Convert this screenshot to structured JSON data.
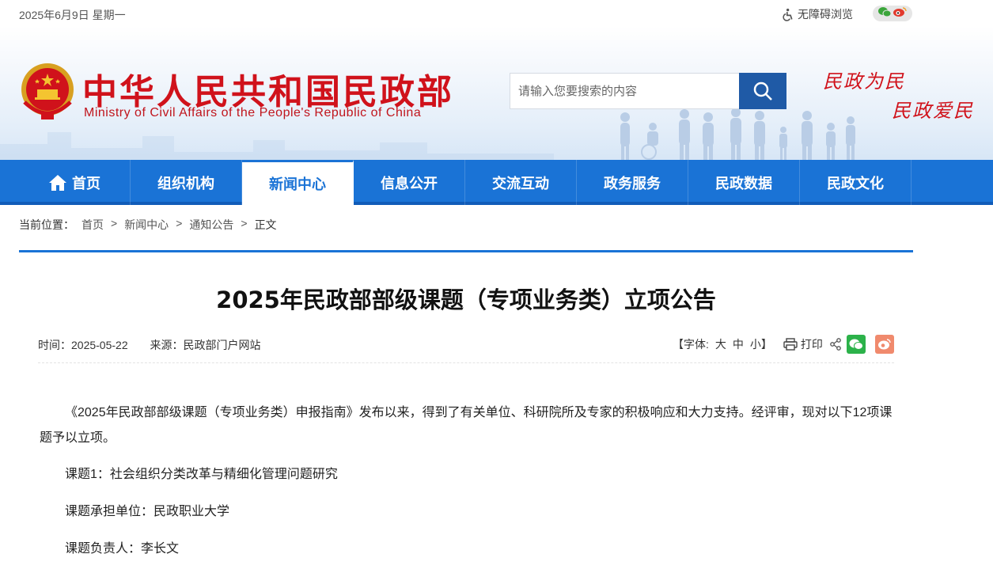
{
  "topbar": {
    "date": "2025年6月9日 星期一",
    "accessibility": "无障碍浏览"
  },
  "header": {
    "title": "中华人民共和国民政部",
    "subtitle": "Ministry of Civil Affairs of the People's Republic of China",
    "search_placeholder": "请输入您要搜索的内容",
    "slogan_line1": "民政为民",
    "slogan_line2": "民政爱民"
  },
  "nav": {
    "items": [
      {
        "label": "首页"
      },
      {
        "label": "组织机构"
      },
      {
        "label": "新闻中心"
      },
      {
        "label": "信息公开"
      },
      {
        "label": "交流互动"
      },
      {
        "label": "政务服务"
      },
      {
        "label": "民政数据"
      },
      {
        "label": "民政文化"
      }
    ],
    "active": "新闻中心"
  },
  "breadcrumb": {
    "label": "当前位置：",
    "items": [
      "首页",
      "新闻中心",
      "通知公告"
    ],
    "separator": ">",
    "current": "正文"
  },
  "article": {
    "title": "2025年民政部部级课题（专项业务类）立项公告",
    "time_label": "时间：",
    "time": "2025-05-22",
    "source_label": "来源：",
    "source": "民政部门户网站",
    "font_label": "【字体:",
    "font_large": "大",
    "font_medium": "中",
    "font_small": "小】",
    "print": "打印",
    "paragraphs": [
      "《2025年民政部部级课题（专项业务类）申报指南》发布以来，得到了有关单位、科研院所及专家的积极响应和大力支持。经评审，现对以下12项课题予以立项。",
      "课题1：社会组织分类改革与精细化管理问题研究",
      "课题承担单位：民政职业大学",
      "课题负责人：李长文"
    ]
  },
  "colors": {
    "brand_red": "#d0121b",
    "nav_blue": "#1a73d6",
    "search_blue": "#1f5aa6"
  }
}
